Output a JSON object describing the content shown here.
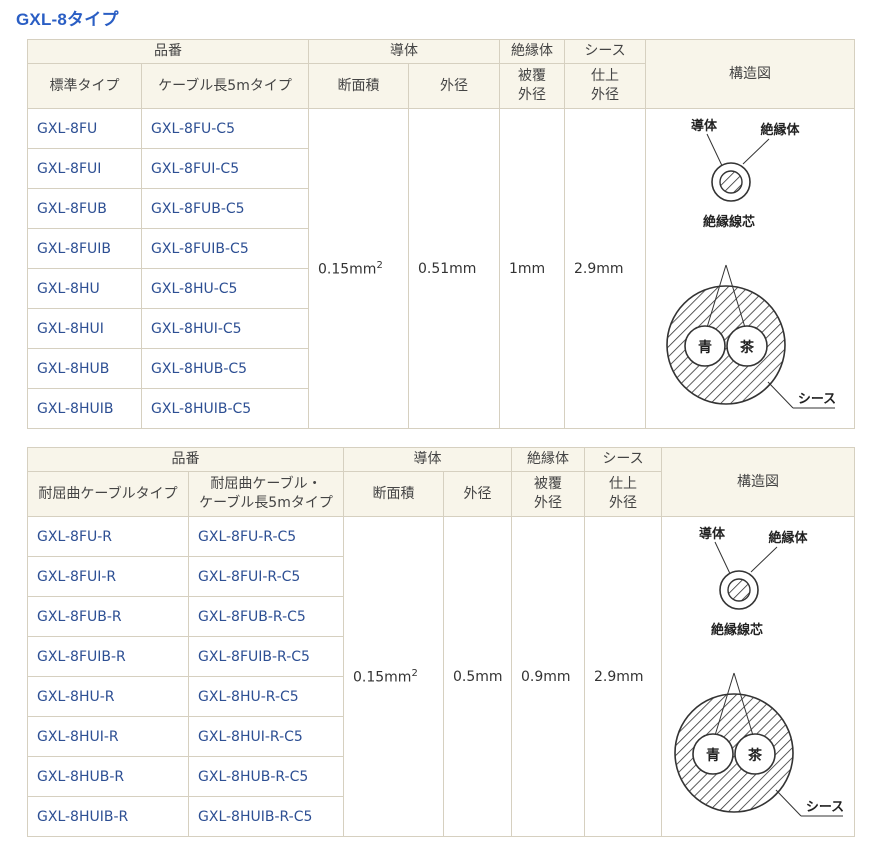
{
  "title": "GXL-8タイプ",
  "tables": [
    {
      "headers": {
        "part_no": "品番",
        "conductor": "導体",
        "insulator": "絶縁体",
        "sheath": "シース",
        "structure": "構造図",
        "col_standard": "標準タイプ",
        "col_cable": "ケーブル長5mタイプ",
        "cross_section": "断面積",
        "outer_dia": "外径",
        "cover_outer_l1": "被覆",
        "cover_outer_l2": "外径",
        "finish_outer_l1": "仕上",
        "finish_outer_l2": "外径"
      },
      "rows": [
        {
          "a": "GXL-8FU",
          "b": "GXL-8FU-C5"
        },
        {
          "a": "GXL-8FUI",
          "b": "GXL-8FUI-C5"
        },
        {
          "a": "GXL-8FUB",
          "b": "GXL-8FUB-C5"
        },
        {
          "a": "GXL-8FUIB",
          "b": "GXL-8FUIB-C5"
        },
        {
          "a": "GXL-8HU",
          "b": "GXL-8HU-C5"
        },
        {
          "a": "GXL-8HUI",
          "b": "GXL-8HUI-C5"
        },
        {
          "a": "GXL-8HUB",
          "b": "GXL-8HUB-C5"
        },
        {
          "a": "GXL-8HUIB",
          "b": "GXL-8HUIB-C5"
        }
      ],
      "specs": {
        "area": "0.15mm",
        "area_sup": "2",
        "conductor_outer": "0.51mm",
        "cover_outer": "1mm",
        "finish_outer": "2.9mm"
      },
      "diagram": {
        "conductor": "導体",
        "insulator": "絶縁体",
        "core": "絶縁線芯",
        "blue": "青",
        "brown": "茶",
        "sheath": "シース"
      }
    },
    {
      "headers": {
        "part_no": "品番",
        "conductor": "導体",
        "insulator": "絶縁体",
        "sheath": "シース",
        "structure": "構造図",
        "col_standard": "耐屈曲ケーブルタイプ",
        "col_cable_l1": "耐屈曲ケーブル・",
        "col_cable_l2": "ケーブル長5mタイプ",
        "cross_section": "断面積",
        "outer_dia": "外径",
        "cover_outer_l1": "被覆",
        "cover_outer_l2": "外径",
        "finish_outer_l1": "仕上",
        "finish_outer_l2": "外径"
      },
      "rows": [
        {
          "a": "GXL-8FU-R",
          "b": "GXL-8FU-R-C5"
        },
        {
          "a": "GXL-8FUI-R",
          "b": "GXL-8FUI-R-C5"
        },
        {
          "a": "GXL-8FUB-R",
          "b": "GXL-8FUB-R-C5"
        },
        {
          "a": "GXL-8FUIB-R",
          "b": "GXL-8FUIB-R-C5"
        },
        {
          "a": "GXL-8HU-R",
          "b": "GXL-8HU-R-C5"
        },
        {
          "a": "GXL-8HUI-R",
          "b": "GXL-8HUI-R-C5"
        },
        {
          "a": "GXL-8HUB-R",
          "b": "GXL-8HUB-R-C5"
        },
        {
          "a": "GXL-8HUIB-R",
          "b": "GXL-8HUIB-R-C5"
        }
      ],
      "specs": {
        "area": "0.15mm",
        "area_sup": "2",
        "conductor_outer": "0.5mm",
        "cover_outer": "0.9mm",
        "finish_outer": "2.9mm"
      },
      "diagram": {
        "conductor": "導体",
        "insulator": "絶縁体",
        "core": "絶縁線芯",
        "blue": "青",
        "brown": "茶",
        "sheath": "シース"
      }
    }
  ]
}
